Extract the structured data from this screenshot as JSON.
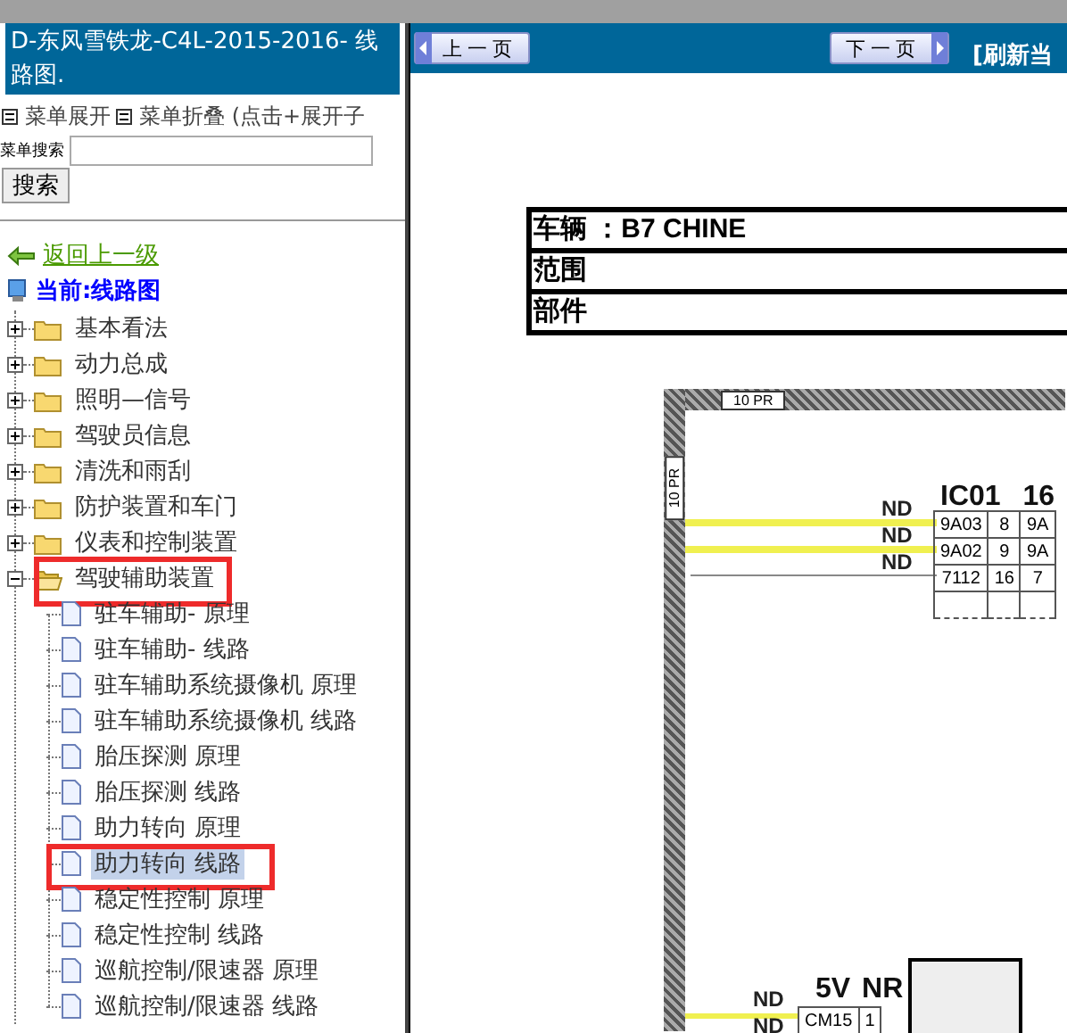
{
  "title": "D-东风雪铁龙-C4L-2015-2016- 线路图.",
  "menu_controls": [
    {
      "label": "菜单展开"
    },
    {
      "label": "菜单折叠 (点击+展开子"
    }
  ],
  "search": {
    "label": "菜单搜索",
    "button": "搜索"
  },
  "back_link": "返回上一级",
  "current": "当前:线路图",
  "tree": [
    {
      "label": "基本看法",
      "expanded": false,
      "annotated": false
    },
    {
      "label": "动力总成",
      "expanded": false,
      "annotated": false
    },
    {
      "label": "照明—信号",
      "expanded": false,
      "annotated": false
    },
    {
      "label": "驾驶员信息",
      "expanded": false,
      "annotated": false
    },
    {
      "label": "清洗和雨刮",
      "expanded": false,
      "annotated": false
    },
    {
      "label": "防护装置和车门",
      "expanded": false,
      "annotated": false
    },
    {
      "label": "仪表和控制装置",
      "expanded": false,
      "annotated": false
    },
    {
      "label": "驾驶辅助装置",
      "expanded": true,
      "annotated": true,
      "children": [
        {
          "label": "驻车辅助- 原理",
          "selected": false,
          "annotated": false
        },
        {
          "label": "驻车辅助- 线路",
          "selected": false,
          "annotated": false
        },
        {
          "label": "驻车辅助系统摄像机 原理",
          "selected": false,
          "annotated": false
        },
        {
          "label": "驻车辅助系统摄像机 线路",
          "selected": false,
          "annotated": false
        },
        {
          "label": "胎压探测 原理",
          "selected": false,
          "annotated": false
        },
        {
          "label": "胎压探测 线路",
          "selected": false,
          "annotated": false
        },
        {
          "label": "助力转向 原理",
          "selected": false,
          "annotated": false
        },
        {
          "label": "助力转向 线路",
          "selected": true,
          "annotated": true
        },
        {
          "label": "稳定性控制 原理",
          "selected": false,
          "annotated": false
        },
        {
          "label": "稳定性控制 线路",
          "selected": false,
          "annotated": false
        },
        {
          "label": "巡航控制/限速器 原理",
          "selected": false,
          "annotated": false
        },
        {
          "label": "巡航控制/限速器 线路",
          "selected": false,
          "annotated": false
        }
      ]
    }
  ],
  "toolbar": {
    "prev": "上一页",
    "next": "下一页",
    "refresh": "[刷新当"
  },
  "info_table": [
    "车辆 ：B7 CHINE",
    "范围",
    "部件"
  ],
  "diagram": {
    "frame_labels": [
      "10 PR",
      "10 PR"
    ],
    "connectors": [
      {
        "title": "IC01 16",
        "wire_labels": [
          "ND",
          "ND",
          "ND"
        ],
        "rows": [
          [
            "9A03",
            "8",
            "9A"
          ],
          [
            "9A02",
            "9",
            "9A"
          ],
          [
            "7112",
            "16",
            "7"
          ]
        ]
      },
      {
        "title": "5V NR",
        "wire_labels": [
          "ND",
          "ND"
        ],
        "rows": [
          [
            "CM15",
            "1"
          ]
        ]
      }
    ]
  }
}
